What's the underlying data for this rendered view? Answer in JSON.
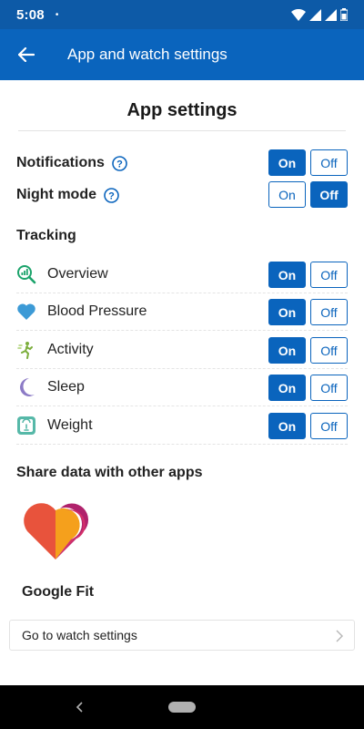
{
  "status_bar": {
    "time": "5:08",
    "dot": "•"
  },
  "app_bar": {
    "title": "App and watch settings",
    "back_icon": "arrow-left-icon"
  },
  "section": {
    "title": "App settings"
  },
  "settings": {
    "notifications": {
      "label": "Notifications",
      "selected": "On"
    },
    "night_mode": {
      "label": "Night mode",
      "selected": "Off"
    },
    "on_label": "On",
    "off_label": "Off"
  },
  "tracking": {
    "title": "Tracking",
    "items": [
      {
        "label": "Overview",
        "icon": "overview-icon",
        "selected": "On"
      },
      {
        "label": "Blood Pressure",
        "icon": "heart-icon",
        "selected": "On"
      },
      {
        "label": "Activity",
        "icon": "activity-icon",
        "selected": "On"
      },
      {
        "label": "Sleep",
        "icon": "moon-icon",
        "selected": "On"
      },
      {
        "label": "Weight",
        "icon": "scale-icon",
        "selected": "On"
      }
    ]
  },
  "share": {
    "title": "Share data with other apps",
    "app_name": "Google Fit",
    "logo_icon": "google-fit-logo"
  },
  "watch_link": {
    "label": "Go to watch settings"
  },
  "colors": {
    "primary": "#0a64bd",
    "status_bar": "#0d5aa7",
    "nav_bar": "#000000"
  }
}
